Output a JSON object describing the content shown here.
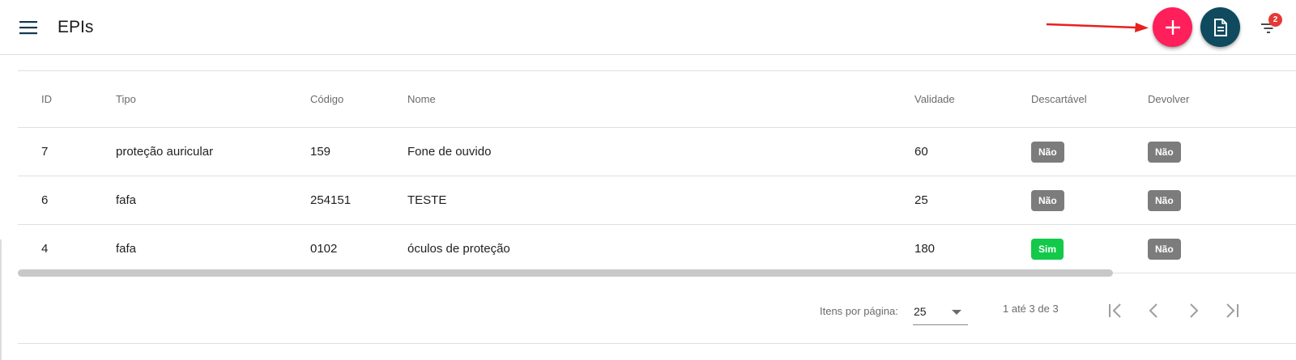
{
  "toolbar": {
    "title": "EPIs",
    "menu_icon": "menu-icon",
    "add_icon": "plus-icon",
    "report_icon": "document-icon",
    "filter_icon": "filter-icon",
    "filter_badge_count": "2",
    "colors": {
      "add_button": "#ff1f5a",
      "report_button": "#0f4a5e",
      "badge": "#e53935",
      "annotation_arrow": "#e8201e"
    }
  },
  "table": {
    "columns": [
      "ID",
      "Tipo",
      "Código",
      "Nome",
      "Validade",
      "Descartável",
      "Devolver"
    ],
    "rows": [
      {
        "id": "7",
        "tipo": "proteção auricular",
        "codigo": "159",
        "nome": "Fone de ouvido",
        "validade": "60",
        "descartavel": "Não",
        "devolver": "Não"
      },
      {
        "id": "6",
        "tipo": "fafa",
        "codigo": "254151",
        "nome": "TESTE",
        "validade": "25",
        "descartavel": "Não",
        "devolver": "Não"
      },
      {
        "id": "4",
        "tipo": "fafa",
        "codigo": "0102",
        "nome": "óculos de proteção",
        "validade": "180",
        "descartavel": "Sim",
        "devolver": "Não"
      }
    ],
    "chip_colors": {
      "Não": "#7c7c7c",
      "Sim": "#12c94a"
    }
  },
  "paginator": {
    "items_per_page_label": "Itens por página:",
    "page_size": "25",
    "range_label": "1 até 3 de 3",
    "icons": [
      "first-page-icon",
      "previous-page-icon",
      "next-page-icon",
      "last-page-icon"
    ]
  }
}
